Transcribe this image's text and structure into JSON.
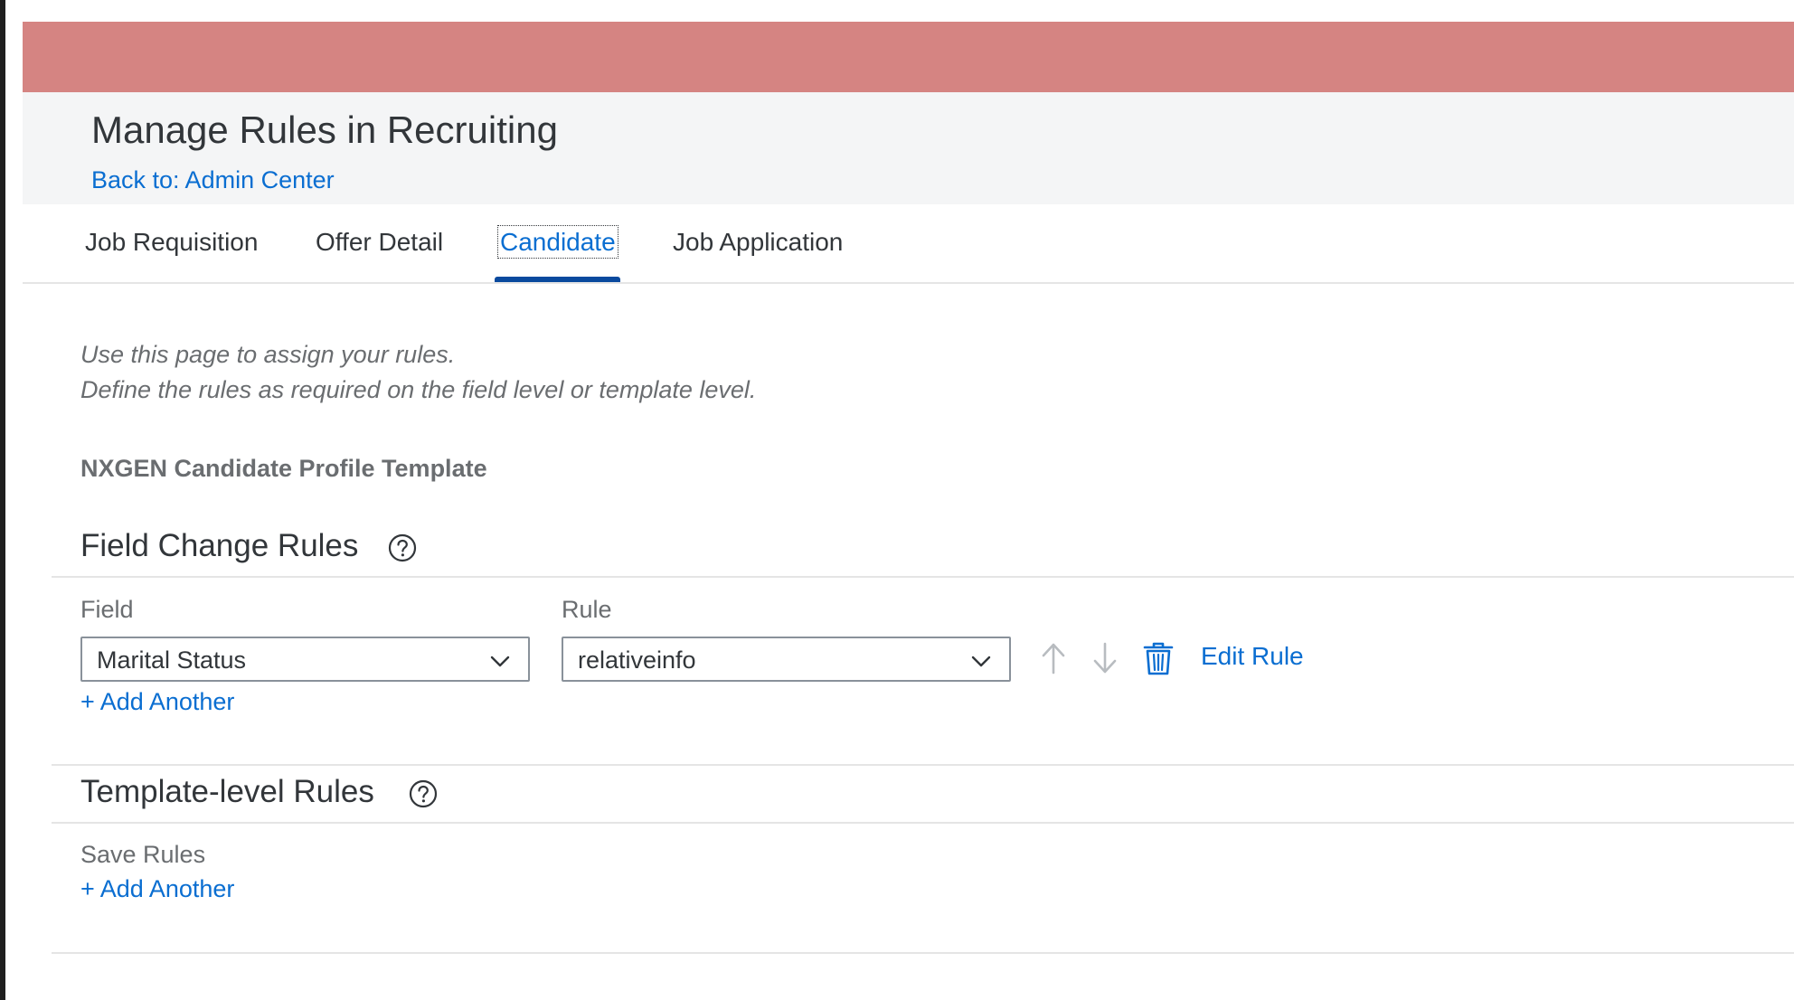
{
  "header": {
    "title": "Manage Rules in Recruiting",
    "back_link": "Back to: Admin Center"
  },
  "tabs": [
    {
      "label": "Job Requisition",
      "active": false
    },
    {
      "label": "Offer Detail",
      "active": false
    },
    {
      "label": "Candidate",
      "active": true
    },
    {
      "label": "Job Application",
      "active": false
    }
  ],
  "intro": {
    "line1": "Use this page to assign your rules.",
    "line2": "Define the rules as required on the field level or template level."
  },
  "template_name": "NXGEN Candidate Profile Template",
  "field_change_rules": {
    "title": "Field Change Rules",
    "help_icon": "question-circle-icon",
    "field_label": "Field",
    "rule_label": "Rule",
    "field_value": "Marital Status",
    "rule_value": "relativeinfo",
    "edit_rule": "Edit Rule",
    "add_another": "+ Add Another"
  },
  "template_level_rules": {
    "title": "Template-level Rules",
    "help_icon": "question-circle-icon",
    "save_rules_label": "Save Rules",
    "add_another": "+ Add Another"
  },
  "colors": {
    "banner": "#d58482",
    "link": "#0a6ed1",
    "tab_indicator": "#0a4a9e",
    "text": "#32363a",
    "muted_text": "#6a6d70",
    "disabled_icon": "#b8bcc0"
  }
}
